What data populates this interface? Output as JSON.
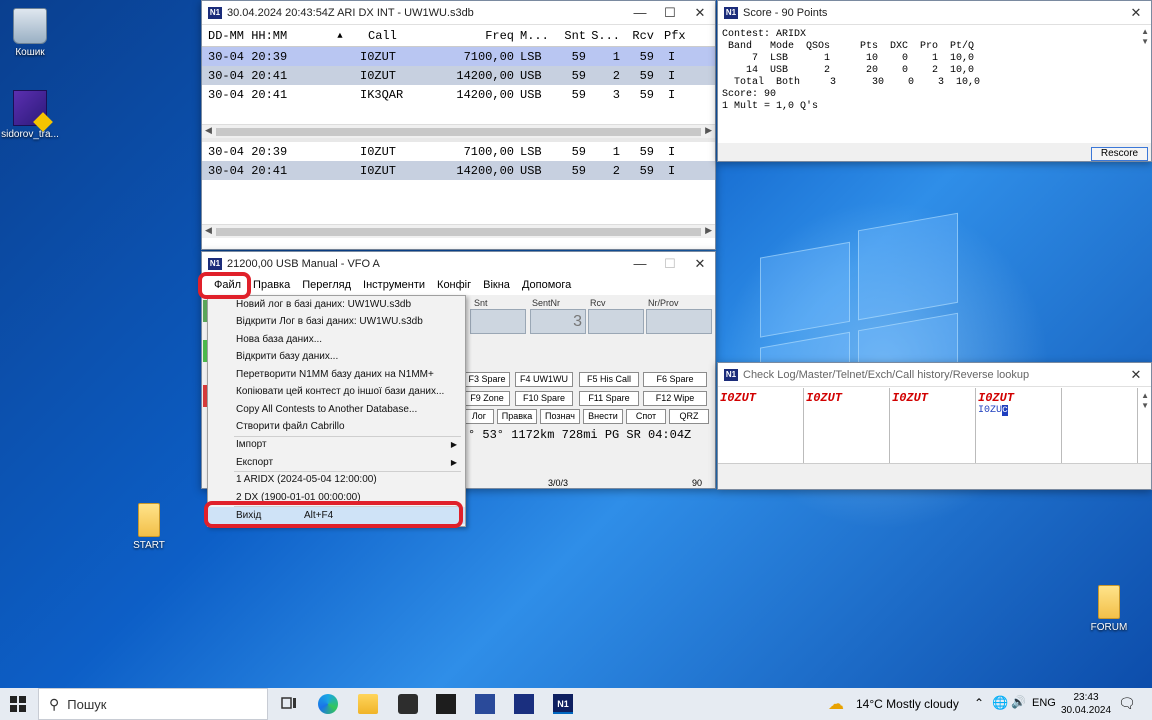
{
  "desktop": {
    "icons": [
      {
        "label": "Кошик"
      },
      {
        "label": "sidorov_tra..."
      },
      {
        "label": "START"
      },
      {
        "label": "FORUM"
      }
    ]
  },
  "log_window": {
    "title": "30.04.2024 20:43:54Z  ARI DX INT - UW1WU.s3db",
    "columns": [
      "DD-MM HH:MM",
      "Call",
      "Freq",
      "M...",
      "Snt",
      "S...",
      "Rcv",
      "Pfx"
    ],
    "rows_top": [
      {
        "date": "30-04 20:39",
        "call": "I0ZUT",
        "freq": "7100,00",
        "mode": "LSB",
        "snt": "59",
        "s": "1",
        "rcv": "59",
        "pfx": "I"
      },
      {
        "date": "30-04 20:41",
        "call": "I0ZUT",
        "freq": "14200,00",
        "mode": "USB",
        "snt": "59",
        "s": "2",
        "rcv": "59",
        "pfx": "I"
      },
      {
        "date": "30-04 20:41",
        "call": "IK3QAR",
        "freq": "14200,00",
        "mode": "USB",
        "snt": "59",
        "s": "3",
        "rcv": "59",
        "pfx": "I"
      }
    ],
    "rows_bottom": [
      {
        "date": "30-04 20:39",
        "call": "I0ZUT",
        "freq": "7100,00",
        "mode": "LSB",
        "snt": "59",
        "s": "1",
        "rcv": "59",
        "pfx": "I"
      },
      {
        "date": "30-04 20:41",
        "call": "I0ZUT",
        "freq": "14200,00",
        "mode": "USB",
        "snt": "59",
        "s": "2",
        "rcv": "59",
        "pfx": "I"
      }
    ]
  },
  "score_window": {
    "title": "Score - 90 Points",
    "text": "Contest: ARIDX\n Band   Mode  QSOs     Pts  DXC  Pro  Pt/Q\n     7  LSB      1      10    0    1  10,0\n    14  USB      2      20    0    2  10,0\n  Total  Both     3      30    0    3  10,0\nScore: 90\n1 Mult = 1,0 Q's",
    "rescore_label": "Rescore"
  },
  "entry_window": {
    "title": "21200,00 USB Manual - VFO A",
    "menu": [
      "Файл",
      "Правка",
      "Перегляд",
      "Інструменти",
      "Конфіг",
      "Вікна",
      "Допомога"
    ],
    "field_labels": [
      "Snt",
      "SentNr",
      "Rcv",
      "Nr/Prov"
    ],
    "sentnr_value": "3",
    "fkeys": [
      "F3 Spare",
      "F4 UW1WU",
      "F5 His Call",
      "F6 Spare",
      "F9 Zone",
      "F10 Spare",
      "F11 Spare",
      "F12 Wipe"
    ],
    "buttons": [
      "Лог",
      "Правка",
      "Познач",
      "Внести",
      "Спот",
      "QRZ"
    ],
    "info_line": "° 53° 1172km 728mi PG  SR 04:04Z",
    "status_mid": "3/0/3",
    "status_right": "90"
  },
  "file_menu": {
    "items": [
      {
        "label": "Новий лог в базі даних: UW1WU.s3db"
      },
      {
        "label": "Відкрити Лог в базі даних: UW1WU.s3db"
      },
      {
        "label": "Нова база даних..."
      },
      {
        "label": "Відкрити базу даних..."
      },
      {
        "label": "Перетворити N1MM базу даних на N1MM+"
      },
      {
        "label": "Копіювати цей контест до іншої бази даних..."
      },
      {
        "label": "Copy All Contests to Another Database..."
      },
      {
        "label": "Створити файл Cabrillo"
      },
      {
        "label": "Імпорт"
      },
      {
        "label": "Експорт"
      },
      {
        "label": "1 ARIDX (2024-05-04 12:00:00)"
      },
      {
        "label": "2 DX (1900-01-01 00:00:00)"
      },
      {
        "label": "Вихід",
        "shortcut": "Alt+F4"
      }
    ]
  },
  "check_window": {
    "title": "Check Log/Master/Telnet/Exch/Call history/Reverse lookup",
    "calls": [
      "I0ZUT",
      "I0ZUT",
      "I0ZUT",
      "I0ZUT"
    ],
    "partial": "I0ZU",
    "partial_cursor": "c"
  },
  "taskbar": {
    "search_placeholder": "Пошук",
    "weather": "14°C  Mostly cloudy",
    "lang": "ENG",
    "time": "23:43",
    "date": "30.04.2024"
  }
}
